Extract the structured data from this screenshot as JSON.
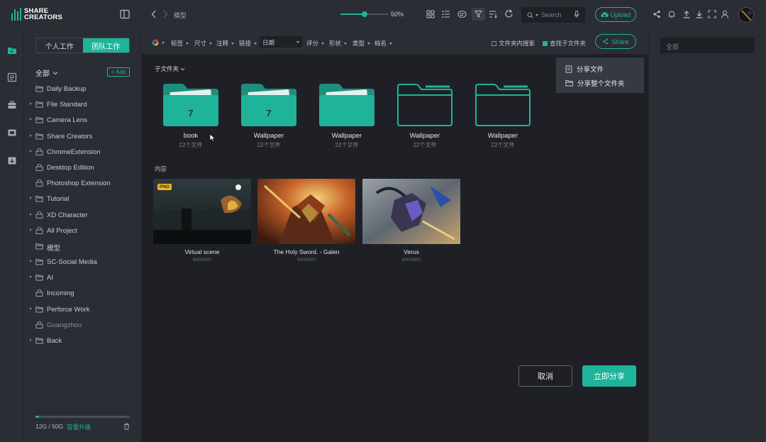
{
  "brand": {
    "line1": "SHARE",
    "line2": "CREATORS",
    "accent": "#1fb39a"
  },
  "topbar": {
    "breadcrumb": "模型",
    "zoom_value": "50%",
    "zoom_level": 0.5,
    "search_placeholder": "Search",
    "upload_label": "Upload"
  },
  "panel": {
    "tab_personal": "个人工作",
    "tab_team": "团队工作",
    "all_label": "全部",
    "add_label": "+ Add",
    "items": [
      {
        "label": "Daily Backup",
        "arrow": false,
        "icon": "folder-icon"
      },
      {
        "label": "File Standard",
        "arrow": true,
        "icon": "folder-icon"
      },
      {
        "label": "Camera Lens",
        "arrow": true,
        "icon": "folder-icon"
      },
      {
        "label": "Share Creators",
        "arrow": true,
        "icon": "folder-icon"
      },
      {
        "label": "ChromeExtension",
        "arrow": true,
        "icon": "lock-icon"
      },
      {
        "label": "Desktop Edition",
        "arrow": false,
        "icon": "lock-icon"
      },
      {
        "label": "Photoshop Extension",
        "arrow": false,
        "icon": "lock-icon"
      },
      {
        "label": "Tutorial",
        "arrow": true,
        "icon": "folder-icon"
      },
      {
        "label": "XD Character",
        "arrow": true,
        "icon": "lock-icon"
      },
      {
        "label": "All Project",
        "arrow": true,
        "icon": "lock-icon"
      },
      {
        "label": "模型",
        "arrow": false,
        "icon": "folder-icon"
      },
      {
        "label": "SC-Social Media",
        "arrow": true,
        "icon": "folder-icon"
      },
      {
        "label": "AI",
        "arrow": true,
        "icon": "folder-icon"
      },
      {
        "label": "Incoming",
        "arrow": false,
        "icon": "lock-icon"
      },
      {
        "label": "Perforce Work",
        "arrow": true,
        "icon": "folder-icon"
      },
      {
        "label": "Guangzhou",
        "arrow": false,
        "icon": "lock-icon",
        "dim": true
      },
      {
        "label": "Back",
        "arrow": true,
        "icon": "folder-icon"
      }
    ],
    "storage_text": "12G / 50G",
    "storage_upgrade": "容量升级",
    "storage_fraction": 0.04
  },
  "filterbar": {
    "tags": "标签",
    "size": "尺寸",
    "notes": "注释",
    "link": "链接",
    "date": "日期",
    "rating": "评分",
    "shape": "形状",
    "type": "类型",
    "filename": "档名",
    "folder_search": "文件夹内搜索",
    "find_subfolders": "查找子文件夹",
    "share_label": "Share"
  },
  "content": {
    "subfolder_label": "子文件夹",
    "content_label": "内容",
    "folders": [
      {
        "name": "book",
        "count": "22个文件",
        "number": "7",
        "filled": true
      },
      {
        "name": "Wallpaper",
        "count": "22个文件",
        "number": "7",
        "filled": true
      },
      {
        "name": "Wallpaper",
        "count": "22个文件",
        "number": "",
        "filled": true
      },
      {
        "name": "Wallpaper",
        "count": "22个文件",
        "number": "",
        "filled": false
      },
      {
        "name": "Wallpaper",
        "count": "22个文件",
        "number": "",
        "filled": false
      }
    ],
    "thumbs": [
      {
        "name": "Virtual scene",
        "size": "800X600",
        "badge": "PNG"
      },
      {
        "name": "The Holy Sword. - Galen",
        "size": "800X600",
        "badge": ""
      },
      {
        "name": "Verus",
        "size": "800X600",
        "badge": ""
      }
    ],
    "dropdown": {
      "share_file": "分享文件",
      "share_folder": "分享整个文件夹"
    },
    "cancel_label": "取消",
    "confirm_label": "立即分享"
  },
  "rightpanel": {
    "input_value": "全部"
  }
}
